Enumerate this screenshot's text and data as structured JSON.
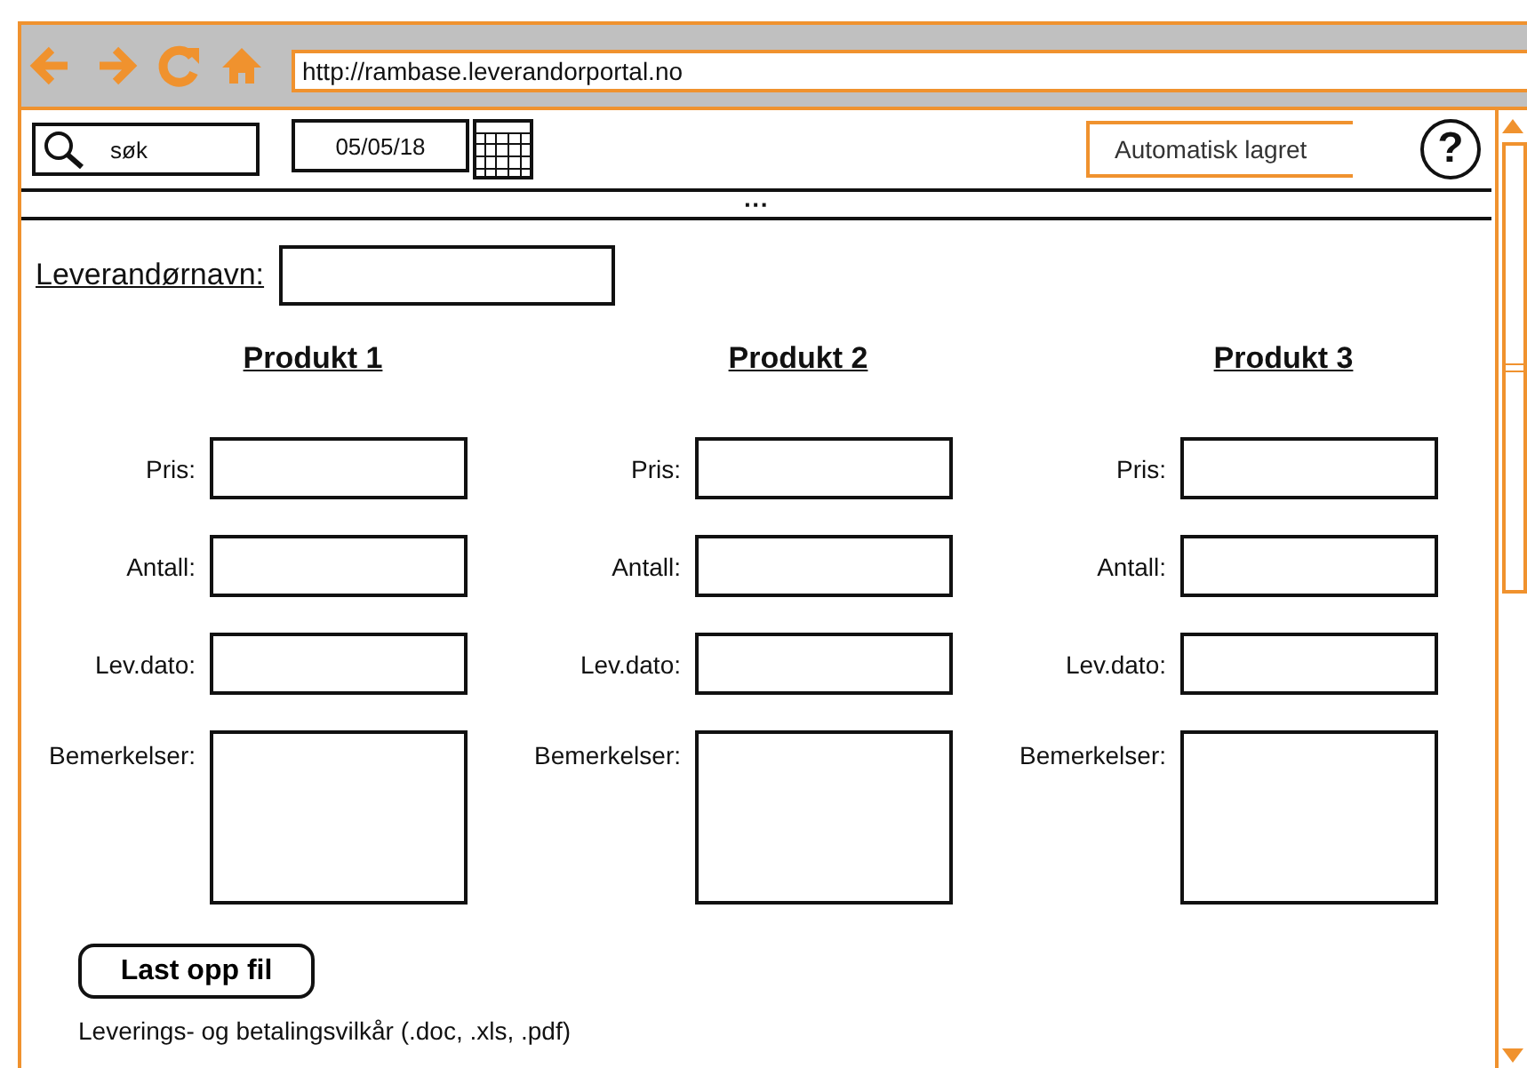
{
  "browser": {
    "url": "http://rambase.leverandorportal.no"
  },
  "toolbar": {
    "search": {
      "value": "søk"
    },
    "date": {
      "value": "05/05/18"
    },
    "status": "Automatisk lagret",
    "help": "?",
    "more": "···"
  },
  "supplier": {
    "label": "Leverandørnavn:"
  },
  "products": [
    {
      "title": "Produkt 1",
      "fields": [
        {
          "kind": "line",
          "label": "Pris:"
        },
        {
          "kind": "line",
          "label": "Antall:"
        },
        {
          "kind": "line",
          "label": "Lev.dato:"
        },
        {
          "kind": "area",
          "label": "Bemerkelser:"
        }
      ]
    },
    {
      "title": "Produkt 2",
      "fields": [
        {
          "kind": "line",
          "label": "Pris:"
        },
        {
          "kind": "line",
          "label": "Antall:"
        },
        {
          "kind": "line",
          "label": "Lev.dato:"
        },
        {
          "kind": "area",
          "label": "Bemerkelser:"
        }
      ]
    },
    {
      "title": "Produkt 3",
      "fields": [
        {
          "kind": "line",
          "label": "Pris:"
        },
        {
          "kind": "line",
          "label": "Antall:"
        },
        {
          "kind": "line",
          "label": "Lev.dato:"
        },
        {
          "kind": "area",
          "label": "Bemerkelser:"
        }
      ]
    }
  ],
  "upload": {
    "button": "Last opp fil",
    "note": "Leverings- og betalingsvilkår (.doc, .xls, .pdf)"
  }
}
